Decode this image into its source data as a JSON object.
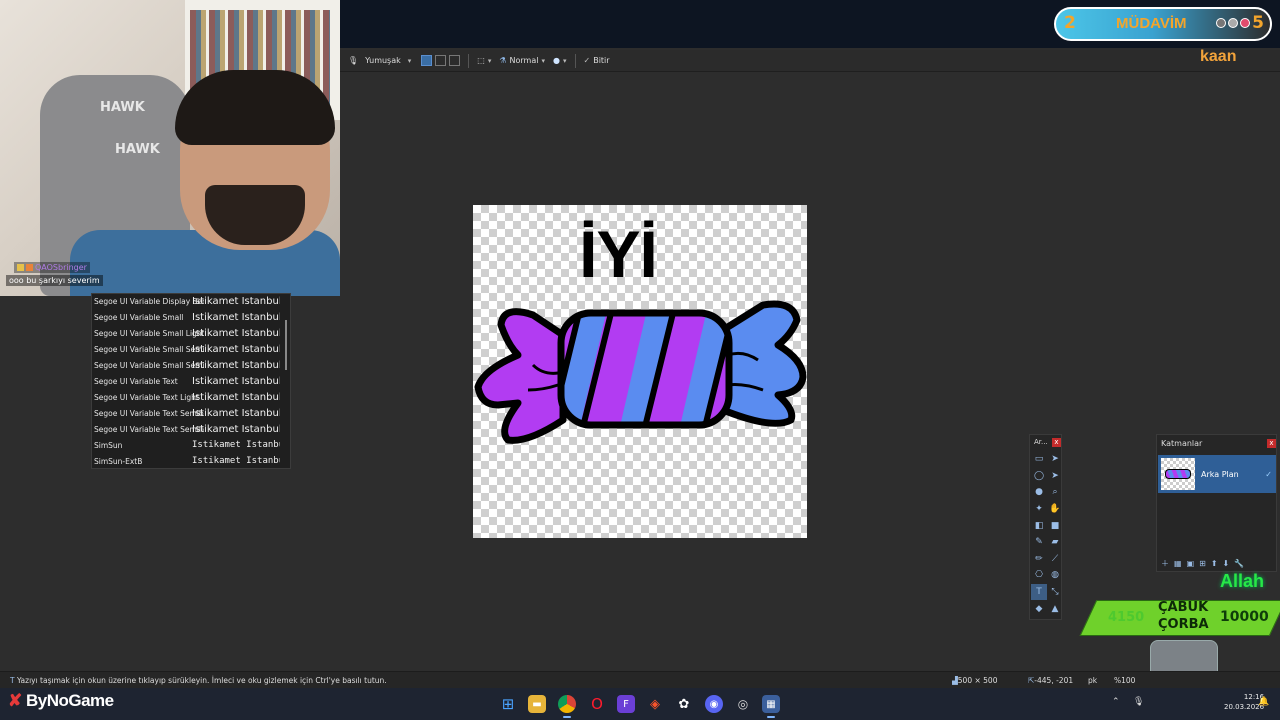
{
  "toolbar": {
    "antialias_label": "Yumuşak",
    "blend_mode_label": "Normal",
    "finish_label": "Bitir"
  },
  "webcam": {
    "chair_logo_1": "HAWK",
    "chair_logo_2": "HAWK",
    "chat_user": "QAOSbringer",
    "chat_message": "ooo bu şarkıyı severim"
  },
  "font_list": [
    {
      "name": "Segoe UI Variable Display Semil",
      "preview": "İstikamet İstanbul",
      "mono": false
    },
    {
      "name": "Segoe UI Variable Small",
      "preview": "İstikamet İstanbul",
      "mono": false
    },
    {
      "name": "Segoe UI Variable Small Light",
      "preview": "İstikamet İstanbul",
      "mono": false
    },
    {
      "name": "Segoe UI Variable Small Semibol",
      "preview": "İstikamet İstanbul",
      "mono": false
    },
    {
      "name": "Segoe UI Variable Small Semilig",
      "preview": "İstikamet İstanbul",
      "mono": false
    },
    {
      "name": "Segoe UI Variable Text",
      "preview": "İstikamet İstanbul",
      "mono": false
    },
    {
      "name": "Segoe UI Variable Text Light",
      "preview": "İstikamet İstanbul",
      "mono": false
    },
    {
      "name": "Segoe UI Variable Text Semibold",
      "preview": "İstikamet İstanbul",
      "mono": false
    },
    {
      "name": "Segoe UI Variable Text Semiligh",
      "preview": "İstikamet İstanbul",
      "mono": false
    },
    {
      "name": "SimSun",
      "preview": "İstikamet İstanbul",
      "mono": true
    },
    {
      "name": "SimSun-ExtB",
      "preview": "İstikamet İstanbul",
      "mono": true
    }
  ],
  "canvas": {
    "text": "İYİ",
    "colors": {
      "purple": "#b23cf2",
      "blue": "#5a8cf0",
      "outline": "#000000"
    }
  },
  "tools_panel": {
    "title": "Ar...",
    "close": "x",
    "tools": [
      "rectangle-select-icon",
      "move-selection-icon",
      "lasso-select-icon",
      "move-selected-icon",
      "ellipse-select-icon",
      "zoom-icon",
      "magic-wand-icon",
      "pan-icon",
      "paint-bucket-icon",
      "shapes-icon",
      "paintbrush-icon",
      "eraser-icon",
      "pencil-icon",
      "color-picker-icon",
      "clone-stamp-icon",
      "recolor-icon",
      "text-icon",
      "line-curve-icon",
      "shapes-tool-icon",
      "gradient-icon"
    ]
  },
  "layers_panel": {
    "title": "Katmanlar",
    "close": "x",
    "layers": [
      {
        "name": "Arka Plan",
        "visible": true
      }
    ]
  },
  "overlays": {
    "mudavim_left": "2",
    "mudavim_label": "MÜDAVİM",
    "mudavim_right": "5",
    "kaan": "kaan",
    "allah": "Allah",
    "corba_value_left": "4150",
    "corba_label_1": "ÇABUK",
    "corba_label_2": "ÇORBA",
    "corba_value_right": "10000"
  },
  "status": {
    "message": "Yazıyı taşımak için okun üzerine tıklayıp sürükleyin. İmleci ve oku gizlemek için Ctrl'ye basılı tutun.",
    "dimensions": "500 × 500",
    "position": "-445, -201",
    "unit": "pk",
    "zoom": "%100"
  },
  "taskbar": {
    "brand_prefix": "By",
    "brand_suffix": "NoGame",
    "time": "12:16",
    "date": "20.03.2026",
    "apps": [
      "windows-start-icon",
      "file-explorer-icon",
      "chrome-icon",
      "opera-icon",
      "app-f-icon",
      "brave-icon",
      "chatgpt-icon",
      "discord-icon",
      "recorder-icon",
      "paint-net-icon"
    ]
  }
}
